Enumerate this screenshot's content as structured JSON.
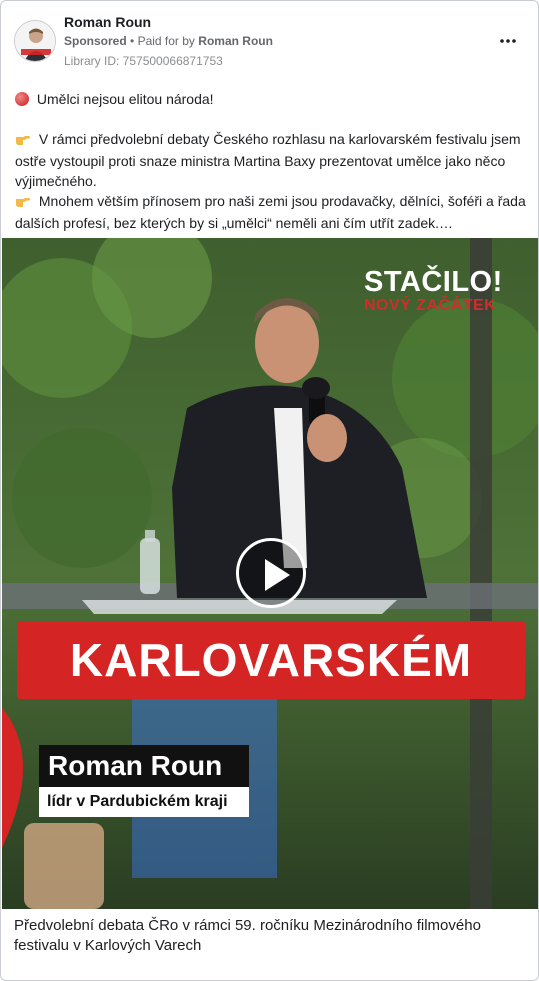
{
  "post": {
    "author": "Roman Roun",
    "sponsored_label": "Sponsored",
    "separator": "•",
    "paid_for_prefix": "Paid for by",
    "paid_for_name": "Roman Roun",
    "library_id": "Library ID: 757500066871753",
    "more_icon": "more-horizontal-icon",
    "avatar_text_top": "STAČILO!",
    "avatar_text_bottom": "NOVÝ ZAČÁTEK"
  },
  "body": {
    "line1": "Umělci nejsou elitou národa!",
    "para2": "V rámci předvolební debaty Českého rozhlasu na karlovarském festivalu jsem ostře vystoupil proti snaze ministra Martina Baxy prezentovat umělce jako něco výjimečného.",
    "para3": "Mnohem větším přínosem pro naši zemi jsou prodavačky, dělníci, šoféři a řada dalších profesí, bez kterých by si „umělci“ neměli ani čím utřít zadek.…",
    "icon_line1": "red-circle-icon",
    "icon_hand": "pointing-hand-icon"
  },
  "media": {
    "brand_top": "STAČILO!",
    "brand_bottom": "NOVÝ ZAČÁTEK",
    "banner": "KARLOVARSKÉM",
    "name_plate": "Roman Roun",
    "role_plate": "lídr v Pardubickém kraji",
    "play_icon": "play-icon"
  },
  "caption": "Předvolební debata ČRo v rámci 59. ročníku Mezinárodního filmového festivalu v Karlových Varech",
  "colors": {
    "accent_red": "#d42424",
    "text_primary": "#1c1e21",
    "text_secondary": "#65676b",
    "border": "#c9ccd1"
  }
}
